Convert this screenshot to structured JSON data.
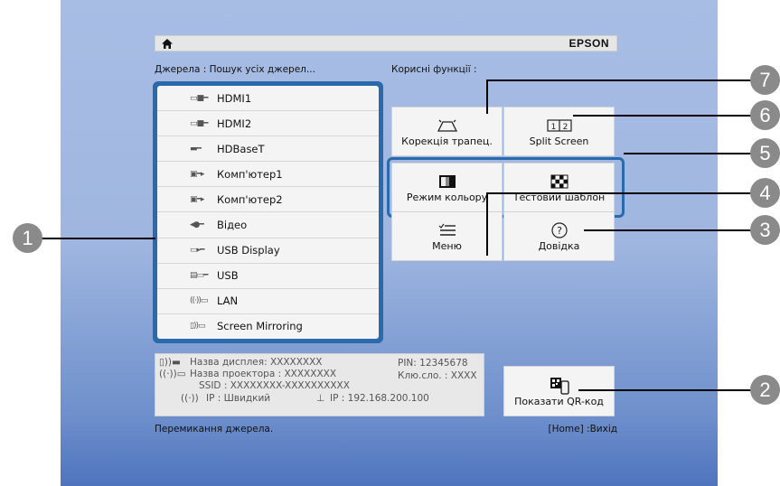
{
  "header": {
    "brand": "EPSON"
  },
  "sources": {
    "label": "Джерела : Пошук усіх джерел...",
    "items": [
      {
        "icon": "hdmi-icon",
        "glyph": "▭■━",
        "label": "HDMI1"
      },
      {
        "icon": "hdmi-icon",
        "glyph": "▭■━",
        "label": "HDMI2"
      },
      {
        "icon": "hdbaset-icon",
        "glyph": "▬━",
        "label": "HDBaseT"
      },
      {
        "icon": "vga-icon",
        "glyph": "▣━▸",
        "label": "Комп'ютер1"
      },
      {
        "icon": "vga-icon",
        "glyph": "▣━▸",
        "label": "Комп'ютер2"
      },
      {
        "icon": "video-icon",
        "glyph": "◂●━",
        "label": "Відео"
      },
      {
        "icon": "usb-display-icon",
        "glyph": "▭▸━",
        "label": "USB Display"
      },
      {
        "icon": "usb-icon",
        "glyph": "▤▭━",
        "label": "USB"
      },
      {
        "icon": "lan-icon",
        "glyph": "((·))▭",
        "label": "LAN"
      },
      {
        "icon": "screen-mirroring-icon",
        "glyph": "▯))▭",
        "label": "Screen Mirroring"
      }
    ]
  },
  "functions": {
    "label": "Корисні функції :",
    "keystone": "Корекція трапец.",
    "split_screen": "Split Screen",
    "color_mode": "Режим кольору",
    "test_pattern": "Тестовий шаблон",
    "menu": "Меню",
    "help": "Довідка",
    "qr": "Показати QR-код"
  },
  "info": {
    "display_name": "Назва дисплея: XXXXXXXX",
    "projector_name": "Назва проектора : XXXXXXXX",
    "ssid": "SSID : XXXXXXXX-XXXXXXXXXX",
    "ip_mode": "IP : Швидкий",
    "pin": "PIN: 12345678",
    "key": "Клю.сло. : XXXX",
    "ip": "IP : 192.168.200.100"
  },
  "status": {
    "hint": "Перемикання джерела.",
    "exit": "[Home] :Вихід"
  },
  "callouts": [
    "1",
    "2",
    "3",
    "4",
    "5",
    "6",
    "7"
  ],
  "colors": {
    "accent": "#2a6aaa",
    "callout": "#8a8a8a"
  }
}
